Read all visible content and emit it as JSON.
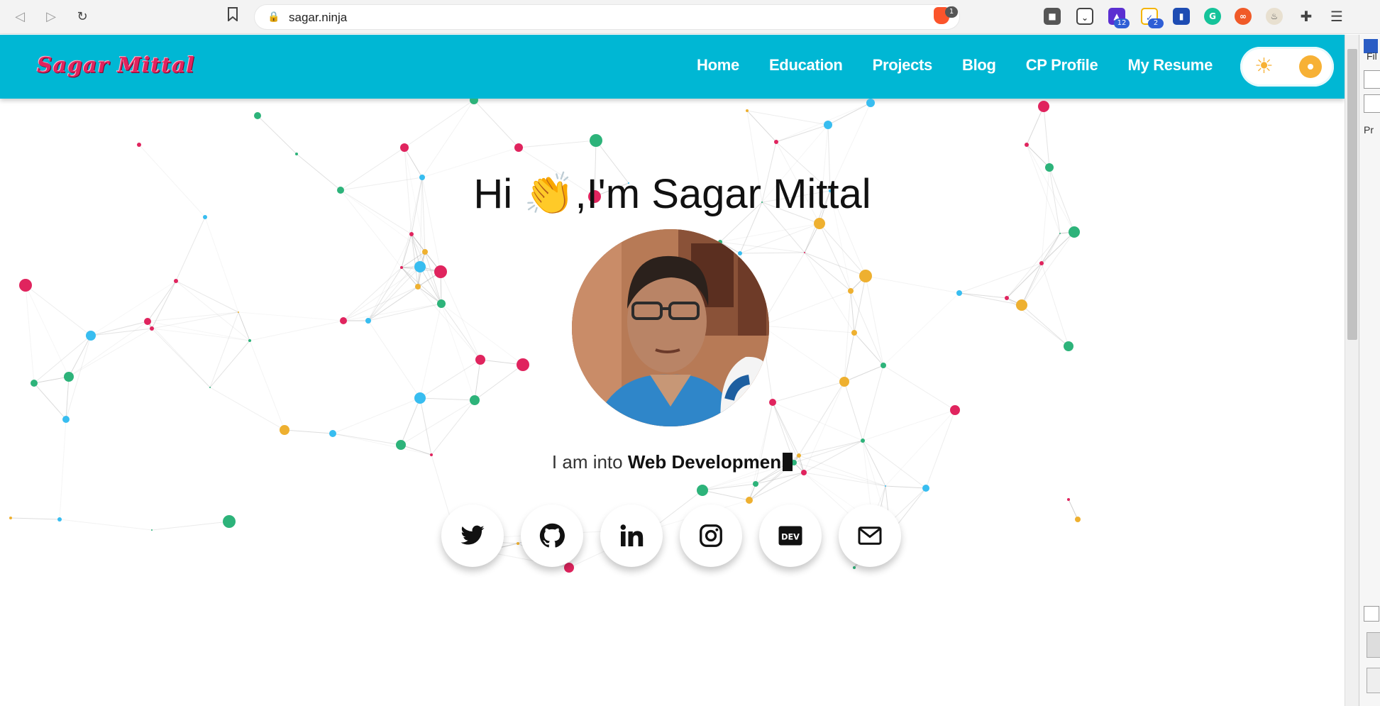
{
  "browser": {
    "url": "sagar.ninja",
    "brave_badge": "1",
    "ext_badges": [
      "12",
      "2"
    ]
  },
  "site": {
    "logo": "Sagar Mittal",
    "nav": [
      "Home",
      "Education",
      "Projects",
      "Blog",
      "CP Profile",
      "My Resume"
    ],
    "theme_toggle": "light"
  },
  "hero": {
    "greeting": "Hi ",
    "wave": "👏",
    "intro": ",I'm ",
    "name": "Sagar Mittal",
    "typed_prefix": "I am into ",
    "typed_role": "Web Developmen"
  },
  "socials": [
    "twitter-icon",
    "github-icon",
    "linkedin-icon",
    "instagram-icon",
    "dev-icon",
    "mail-icon"
  ],
  "side_panel": {
    "labels": [
      "Fil",
      "Pr"
    ]
  },
  "colors": {
    "header": "#00b7d4",
    "logo": "#e0245e",
    "particle_pink": "#e0245e",
    "particle_green": "#2db37a",
    "particle_blue": "#38bdf0",
    "particle_yellow": "#eeb030",
    "toggle_knob": "#f7b135"
  }
}
